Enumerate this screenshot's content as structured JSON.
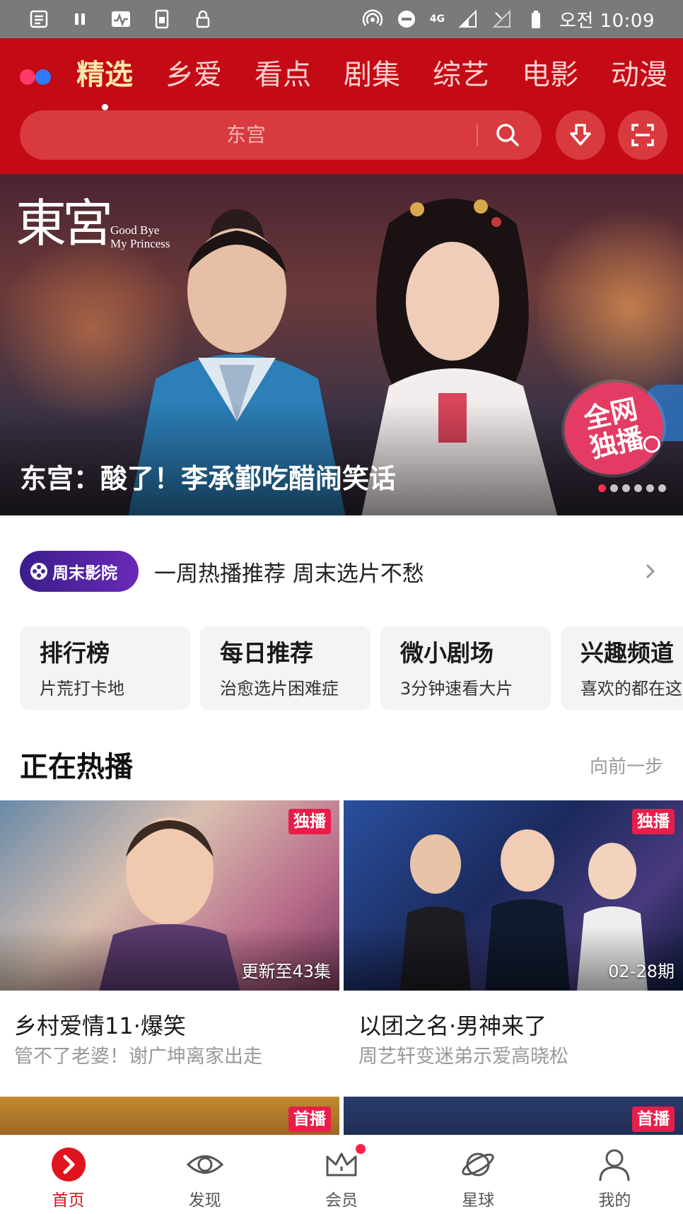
{
  "status_bar": {
    "network": "4G",
    "time": "오전 10:09"
  },
  "header": {
    "tabs": [
      {
        "label": "精选",
        "active": true
      },
      {
        "label": "乡爱",
        "active": false
      },
      {
        "label": "看点",
        "active": false
      },
      {
        "label": "剧集",
        "active": false
      },
      {
        "label": "综艺",
        "active": false
      },
      {
        "label": "电影",
        "active": false
      },
      {
        "label": "动漫",
        "active": false
      }
    ],
    "search": {
      "placeholder": "东宫"
    }
  },
  "banner": {
    "logo_cn": "東宮",
    "logo_en_line1": "Good Bye",
    "logo_en_line2": "My Princess",
    "badge_line1": "全网",
    "badge_line2": "独播",
    "title": "东宫：酸了！李承鄞吃醋闹笑话",
    "dot_count": 6,
    "active_dot": 1
  },
  "weekend": {
    "pill_label": "周末影院",
    "text": "一周热播推荐 周末选片不愁"
  },
  "cards": [
    {
      "title": "排行榜",
      "subtitle": "片荒打卡地"
    },
    {
      "title": "每日推荐",
      "subtitle": "治愈选片困难症"
    },
    {
      "title": "微小剧场",
      "subtitle": "3分钟速看大片"
    },
    {
      "title": "兴趣频道",
      "subtitle": "喜欢的都在这"
    }
  ],
  "section": {
    "title": "正在热播",
    "more": "向前一步"
  },
  "shows": [
    {
      "tag": "独播",
      "caption": "更新至43集",
      "title": "乡村爱情11·爆笑",
      "subtitle": "管不了老婆！谢广坤离家出走"
    },
    {
      "tag": "独播",
      "caption": "02-28期",
      "title": "以团之名·男神来了",
      "subtitle": "周艺轩变迷弟示爱高晓松"
    }
  ],
  "shows_next": [
    {
      "tag": "首播"
    },
    {
      "tag": "首播"
    }
  ],
  "bottom_nav": [
    {
      "label": "首页",
      "icon": "home-play-icon",
      "active": true
    },
    {
      "label": "发现",
      "icon": "eye-icon",
      "active": false
    },
    {
      "label": "会员",
      "icon": "crown-icon",
      "active": false,
      "badge_dot": true
    },
    {
      "label": "星球",
      "icon": "planet-icon",
      "active": false
    },
    {
      "label": "我的",
      "icon": "user-icon",
      "active": false
    }
  ],
  "colors": {
    "brand_red": "#c40a14",
    "active_tab": "#ffe9a8",
    "tag_red": "#e81e4a",
    "nav_active": "#d4101e"
  }
}
